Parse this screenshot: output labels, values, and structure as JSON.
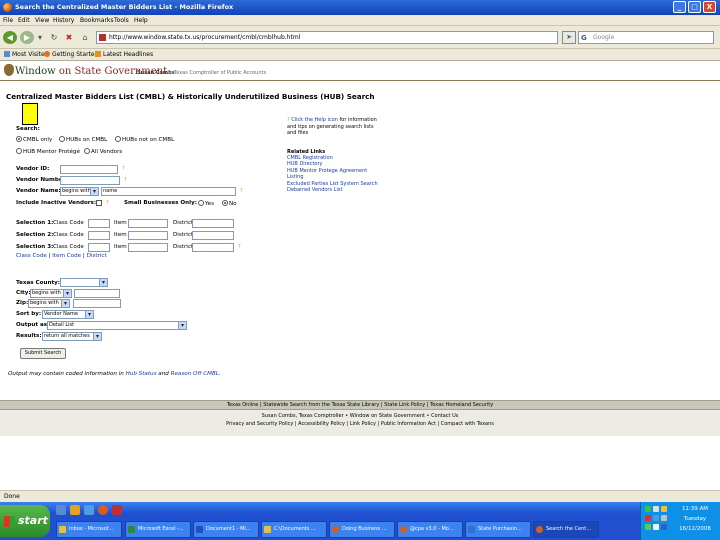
{
  "window": {
    "title": "Search the Centralized Master Bidders List - Mozilla Firefox",
    "minimize": "_",
    "maximize": "□",
    "close": "X"
  },
  "menu": [
    "File",
    "Edit",
    "View",
    "History",
    "Bookmarks",
    "Tools",
    "Help"
  ],
  "nav": {
    "url": "http://www.window.state.tx.us/procurement/cmbl/cmblhub.html",
    "search_placeholder": "Google",
    "search_engine_glyph": "G"
  },
  "bookmarks": [
    "Most Visited",
    "Getting Started",
    "Latest Headlines"
  ],
  "banner": {
    "logo_part1": "Window",
    "logo_part2": " on State Government",
    "name": "Susan Combs",
    "role": "Texas Comptroller of Public Accounts"
  },
  "page": {
    "title": "Centralized Master Bidders List (CMBL) & Historically Underutilized Business (HUB) Search",
    "search_label": "Search:",
    "search_options": [
      {
        "label": "CMBL only",
        "checked": true
      },
      {
        "label": "HUBs on CMBL",
        "checked": false
      },
      {
        "label": "HUBs not on CMBL",
        "checked": false
      },
      {
        "label": "HUB Mentor Protégé",
        "checked": false
      },
      {
        "label": "All Vendors",
        "checked": false
      }
    ],
    "vendor_id_label": "Vendor ID:",
    "vendor_number_label": "Vendor Number:",
    "vendor_name_label": "Vendor Name:",
    "vendor_name_mode": "begins with",
    "vendor_name_value": "name",
    "inactive_label": "Include Inactive Vendors:",
    "small_biz_label": "Small Businesses Only:",
    "small_biz_yes": "Yes",
    "small_biz_no": "No",
    "help_mark": "?",
    "selections": [
      {
        "label": "Selection 1:",
        "class_code": "Class Code",
        "item": "Item",
        "district": "District"
      },
      {
        "label": "Selection 2:",
        "class_code": "Class Code",
        "item": "Item",
        "district": "District"
      },
      {
        "label": "Selection 3:",
        "class_code": "Class Code",
        "item": "Item",
        "district": "District"
      }
    ],
    "code_links": [
      "Class Code",
      "Item Code",
      "District"
    ],
    "code_link_sep": " | ",
    "county_label": "Texas County:",
    "city_label": "City:",
    "city_mode": "begins with",
    "zip_label": "Zip:",
    "zip_mode": "begins with",
    "sort_label": "Sort by:",
    "sort_value": "Vendor Name",
    "output_label": "Output as:",
    "output_value": "Detail List",
    "results_label": "Results:",
    "results_value": "return all matches",
    "submit_label": "Submit Search",
    "note_prefix": "Output may contain coded information in ",
    "note_link1": "Hub Status",
    "note_mid": " and ",
    "note_link2": "Reason Off CMBL",
    "note_suffix": "."
  },
  "right": {
    "help_link": "Click the Help icon",
    "help_text": "for information and tips on generating search lists and files",
    "related_title": "Related Links",
    "links": [
      "CMBL Registration",
      "HUB Directory",
      "HUB Mentor Protege Agreement Listing",
      "Excluded Parties List System Search",
      "Debarred Vendors List"
    ]
  },
  "footer": {
    "row1": [
      "Texas Online",
      "Statewide Search from the Texas State Library",
      "State Link Policy",
      "Texas Homeland Security"
    ],
    "sep": " | ",
    "row2": [
      "Susan Combs, Texas Comptroller",
      "Window on State Government",
      "Contact Us"
    ],
    "bullet": " • ",
    "row3": [
      "Privacy and Security Policy",
      "Accessibility Policy",
      "Link Policy",
      "Public Information Act",
      "Compact with Texans"
    ]
  },
  "status": "Done",
  "taskbar": {
    "start": "start",
    "tasks": [
      {
        "label": "Inbox - Microsof...",
        "color": "#e8c040"
      },
      {
        "label": "Microsoft Excel -...",
        "color": "#2a8a3a"
      },
      {
        "label": "Document1 - Mi...",
        "color": "#2050c0"
      },
      {
        "label": "C:\\Documents ...",
        "color": "#e8c040"
      },
      {
        "label": "Doing Business ...",
        "color": "#d06020"
      },
      {
        "label": "@cpa v3.0 - Mo...",
        "color": "#d06020"
      },
      {
        "label": "State Purchasin...",
        "color": "#3070d0"
      },
      {
        "label": "Search the Cent...",
        "color": "#d06020"
      }
    ],
    "clock_time": "11:39 AM",
    "clock_day": "Tuesday",
    "clock_date": "16/12/2008"
  }
}
